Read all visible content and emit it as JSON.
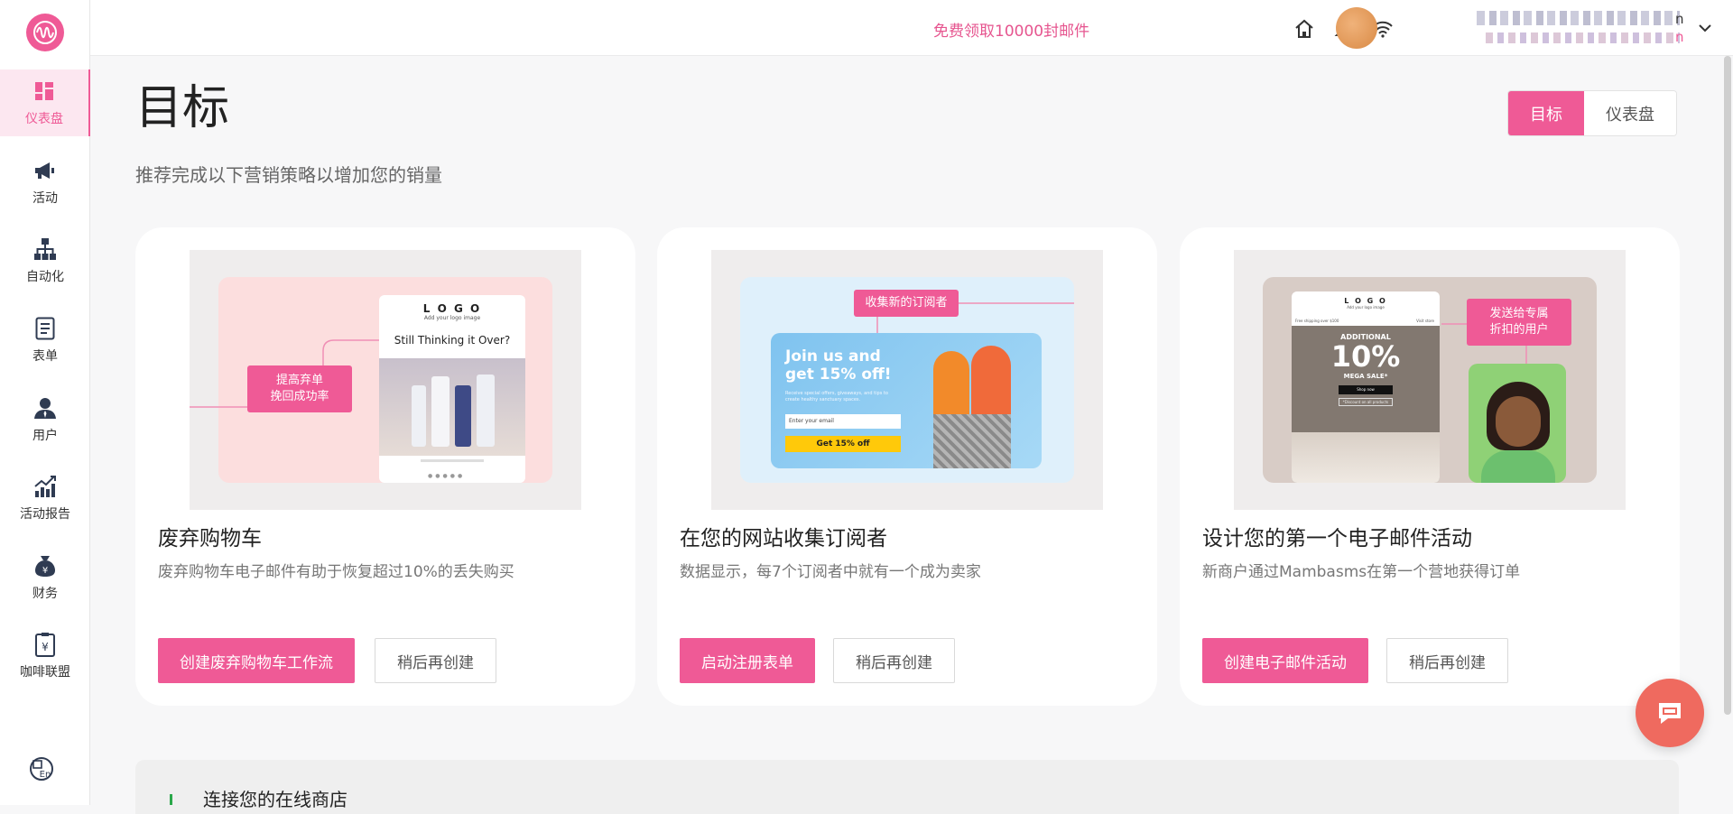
{
  "sidebar": {
    "items": [
      {
        "label": "仪表盘",
        "icon": "dashboard-icon",
        "active": true
      },
      {
        "label": "活动",
        "icon": "megaphone-icon"
      },
      {
        "label": "自动化",
        "icon": "hierarchy-icon"
      },
      {
        "label": "表单",
        "icon": "form-icon"
      },
      {
        "label": "用户",
        "icon": "user-icon"
      },
      {
        "label": "活动报告",
        "icon": "chart-icon"
      },
      {
        "label": "财务",
        "icon": "money-bag-icon"
      },
      {
        "label": "咖啡联盟",
        "icon": "clipboard-yen-icon"
      }
    ]
  },
  "topbar": {
    "promo": "免费领取10000封邮件",
    "user_suffix_1": "n",
    "user_suffix_2": "n"
  },
  "page": {
    "title": "目标",
    "subtitle": "推荐完成以下营销策略以增加您的销量",
    "toggle": [
      "目标",
      "仪表盘"
    ]
  },
  "cards": [
    {
      "title": "废弃购物车",
      "desc": "废弃购物车电子邮件有助于恢复超过10%的丢失购买",
      "primary": "创建废弃购物车工作流",
      "secondary": "稍后再创建",
      "img_tag": "提高弃单\n挽回成功率",
      "img_logo": "L O G O",
      "img_logo_sub": "Add your logo image",
      "img_heading": "Still Thinking it Over?"
    },
    {
      "title": "在您的网站收集订阅者",
      "desc": "数据显示，每7个订阅者中就有一个成为卖家",
      "primary": "启动注册表单",
      "secondary": "稍后再创建",
      "img_tag": "收集新的订阅者",
      "img_heading": "Join us and get 15% off!",
      "img_small": "Receive special offers, giveaways, and tips to create healthy sanctuary spaces.",
      "img_input": "Enter your email",
      "img_btn": "Get 15% off"
    },
    {
      "title": "设计您的第一个电子邮件活动",
      "desc": "新商户通过Mambasms在第一个营地获得订单",
      "primary": "创建电子邮件活动",
      "secondary": "稍后再创建",
      "img_tag": "发送给专属\n折扣的用户",
      "img_logo": "L O G O",
      "img_logo_sub": "Add your logo image",
      "img_free": "Free shipping over $100",
      "img_visit": "Visit store",
      "img_additional": "ADDITIONAL",
      "img_pct": "10%",
      "img_sale": "MEGA SALE*",
      "img_shop": "Shop now",
      "img_all": "*Discount on all products"
    }
  ],
  "bottom": {
    "title": "连接您的在线商店"
  }
}
